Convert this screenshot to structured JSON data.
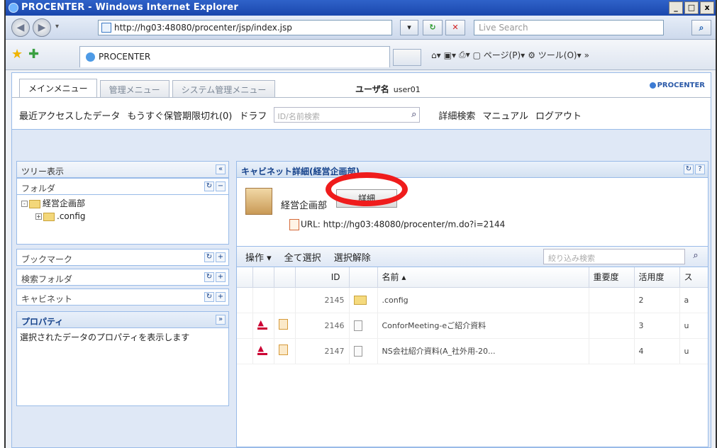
{
  "window": {
    "title": "PROCENTER - Windows Internet Explorer",
    "buttons": [
      "_",
      "□",
      "x"
    ]
  },
  "browser": {
    "url": "http://hg03:48080/procenter/jsp/index.jsp",
    "search_placeholder": "Live Search",
    "tab_title": "PROCENTER",
    "tools": [
      "ページ(P)",
      "ツール(O)"
    ]
  },
  "app": {
    "menu_tabs": [
      "メインメニュー",
      "管理メニュー",
      "システム管理メニュー"
    ],
    "username_label": "ユーザ名",
    "username": "user01",
    "brand": "PROCENTER",
    "nav_links": {
      "recent": "最近アクセスしたデータ",
      "expiring": "もうすぐ保管期限切れ(0)",
      "draft": "ドラフ",
      "name_search_placeholder": "ID/名前検索",
      "advanced_search": "詳細検索",
      "manual": "マニュアル",
      "logout": "ログアウト"
    }
  },
  "left_panel": {
    "tree_title": "ツリー表示",
    "folder_title": "フォルダ",
    "tree_items": [
      {
        "label": "経営企画部",
        "toggle": "-"
      },
      {
        "label": ".config",
        "toggle": "+"
      }
    ],
    "sections": [
      "ブックマーク",
      "検索フォルダ",
      "キャビネット"
    ],
    "property_title": "プロパティ",
    "property_text": "選択されたデータのプロパティを表示します"
  },
  "main_panel": {
    "title": "キャビネット詳細(経営企画部)",
    "cabinet_name": "経営企画部",
    "detail_button": "詳細",
    "url_text": "URL: http://hg03:48080/procenter/m.do?i=2144",
    "toolbar": {
      "operation": "操作 ▾",
      "select_all": "全て選択",
      "deselect": "選択解除",
      "filter_placeholder": "絞り込み検索"
    },
    "columns": [
      "ID",
      "名前 ▴",
      "重要度",
      "活用度",
      "ス"
    ],
    "rows": [
      {
        "id": "2145",
        "name": ".config",
        "importance": "",
        "usage": "2",
        "status": "a",
        "type": "folder"
      },
      {
        "id": "2146",
        "name": "ConforMeeting-eご紹介資料",
        "importance": "",
        "usage": "3",
        "status": "u",
        "type": "file"
      },
      {
        "id": "2147",
        "name": "NS会社紹介資料(A_社外用-20...",
        "importance": "",
        "usage": "4",
        "status": "u",
        "type": "file"
      }
    ]
  },
  "annotation": {
    "color": "#ef1c1c"
  }
}
